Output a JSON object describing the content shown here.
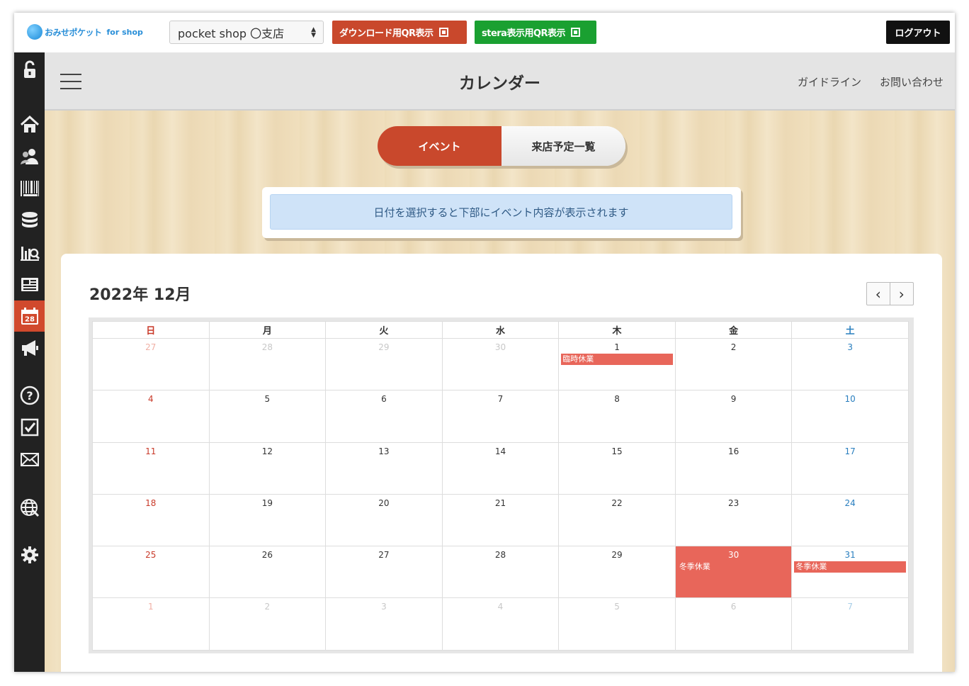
{
  "brand": {
    "logo_text": "おみせポケット",
    "logo_sub": "for shop"
  },
  "top": {
    "shop_select": "pocket shop 〇支店",
    "download_qr": "ダウンロード用QR表示",
    "stera_qr": "stera表示用QR表示",
    "logout": "ログアウト"
  },
  "sidebar": {
    "items": [
      {
        "icon": "unlock-icon"
      },
      {
        "icon": "home-icon"
      },
      {
        "icon": "users-icon"
      },
      {
        "icon": "barcode-icon"
      },
      {
        "icon": "database-icon"
      },
      {
        "icon": "analytics-icon"
      },
      {
        "icon": "news-icon"
      },
      {
        "icon": "calendar-icon",
        "label": "28",
        "active": true
      },
      {
        "icon": "megaphone-icon"
      },
      {
        "icon": "help-icon"
      },
      {
        "icon": "checkbox-icon"
      },
      {
        "icon": "mail-icon"
      },
      {
        "icon": "globe-icon"
      },
      {
        "icon": "gear-icon"
      }
    ]
  },
  "header": {
    "title": "カレンダー",
    "guideline": "ガイドライン",
    "contact": "お問い合わせ"
  },
  "toggle": {
    "event": "イベント",
    "visit_list": "来店予定一覧"
  },
  "notice": "日付を選択すると下部にイベント内容が表示されます",
  "calendar": {
    "title": "2022年 12月",
    "prev": "‹",
    "next": "›",
    "weekdays": [
      "日",
      "月",
      "火",
      "水",
      "木",
      "金",
      "土"
    ],
    "weeks": [
      [
        {
          "d": "27",
          "o": true
        },
        {
          "d": "28",
          "o": true
        },
        {
          "d": "29",
          "o": true
        },
        {
          "d": "30",
          "o": true
        },
        {
          "d": "1",
          "ev": "臨時休業"
        },
        {
          "d": "2"
        },
        {
          "d": "3"
        }
      ],
      [
        {
          "d": "4"
        },
        {
          "d": "5"
        },
        {
          "d": "6"
        },
        {
          "d": "7"
        },
        {
          "d": "8"
        },
        {
          "d": "9"
        },
        {
          "d": "10"
        }
      ],
      [
        {
          "d": "11"
        },
        {
          "d": "12"
        },
        {
          "d": "13"
        },
        {
          "d": "14"
        },
        {
          "d": "15"
        },
        {
          "d": "16"
        },
        {
          "d": "17"
        }
      ],
      [
        {
          "d": "18"
        },
        {
          "d": "19"
        },
        {
          "d": "20"
        },
        {
          "d": "21"
        },
        {
          "d": "22"
        },
        {
          "d": "23"
        },
        {
          "d": "24"
        }
      ],
      [
        {
          "d": "25"
        },
        {
          "d": "26"
        },
        {
          "d": "27"
        },
        {
          "d": "28"
        },
        {
          "d": "29"
        },
        {
          "d": "30",
          "ev": "冬季休業",
          "hl": true
        },
        {
          "d": "31",
          "ev": "冬季休業"
        }
      ],
      [
        {
          "d": "1",
          "o": true
        },
        {
          "d": "2",
          "o": true
        },
        {
          "d": "3",
          "o": true
        },
        {
          "d": "4",
          "o": true
        },
        {
          "d": "5",
          "o": true
        },
        {
          "d": "6",
          "o": true
        },
        {
          "d": "7",
          "o": true
        }
      ]
    ]
  },
  "colors": {
    "accent": "#c9482c",
    "green": "#1aa031",
    "event": "#e8665a",
    "sunday": "#c93a2a",
    "saturday": "#2a7fbf"
  }
}
